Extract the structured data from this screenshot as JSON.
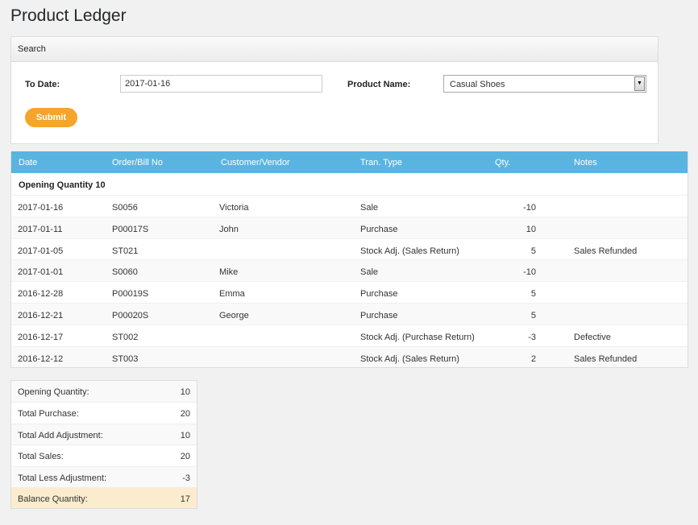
{
  "page": {
    "title": "Product Ledger"
  },
  "search": {
    "header": "Search",
    "to_date_label": "To Date:",
    "to_date_value": "2017-01-16",
    "product_label": "Product Name:",
    "product_value": "Casual Shoes",
    "submit_label": "Submit"
  },
  "ledger": {
    "columns": [
      "Date",
      "Order/Bill No",
      "Customer/Vendor",
      "Tran. Type",
      "Qty.",
      "Notes"
    ],
    "opening": "Opening Quantity 10",
    "rows": [
      {
        "date": "2017-01-16",
        "no": "S0056",
        "party": "Victoria",
        "type": "Sale",
        "qty": "-10",
        "notes": ""
      },
      {
        "date": "2017-01-11",
        "no": "P00017S",
        "party": "John",
        "type": "Purchase",
        "qty": "10",
        "notes": ""
      },
      {
        "date": "2017-01-05",
        "no": "ST021",
        "party": "",
        "type": "Stock Adj.  (Sales Return)",
        "qty": "5",
        "notes": "Sales Refunded"
      },
      {
        "date": "2017-01-01",
        "no": "S0060",
        "party": "Mike",
        "type": "Sale",
        "qty": "-10",
        "notes": ""
      },
      {
        "date": "2016-12-28",
        "no": "P00019S",
        "party": "Emma",
        "type": "Purchase",
        "qty": "5",
        "notes": ""
      },
      {
        "date": "2016-12-21",
        "no": "P00020S",
        "party": "George",
        "type": "Purchase",
        "qty": "5",
        "notes": ""
      },
      {
        "date": "2016-12-17",
        "no": "ST002",
        "party": "",
        "type": "Stock Adj.  (Purchase Return)",
        "qty": "-3",
        "notes": "Defective"
      },
      {
        "date": "2016-12-12",
        "no": "ST003",
        "party": "",
        "type": "Stock Adj.  (Sales Return)",
        "qty": "2",
        "notes": "Sales Refunded"
      }
    ]
  },
  "summary": [
    {
      "label": "Opening Quantity:",
      "value": "10"
    },
    {
      "label": "Total Purchase:",
      "value": "20"
    },
    {
      "label": "Total Add Adjustment:",
      "value": "10"
    },
    {
      "label": "Total Sales:",
      "value": "20"
    },
    {
      "label": "Total Less Adjustment:",
      "value": "-3"
    },
    {
      "label": "Balance Quantity:",
      "value": "17"
    }
  ]
}
